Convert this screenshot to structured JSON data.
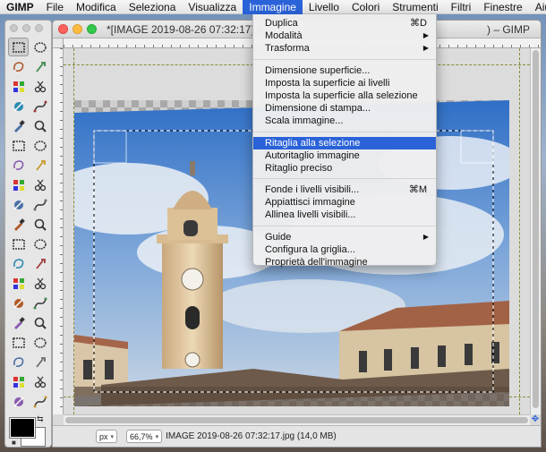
{
  "menubar": {
    "apple": "",
    "items": [
      "GIMP",
      "File",
      "Modifica",
      "Seleziona",
      "Visualizza",
      "Immagine",
      "Livello",
      "Colori",
      "Strumenti",
      "Filtri",
      "Finestre",
      "Aiuto"
    ],
    "active": "Immagine"
  },
  "window": {
    "title": "*[IMAGE 2019-08-26 07:32:17] (i",
    "title_suffix": ") – GIMP"
  },
  "menu": {
    "duplica": "Duplica",
    "duplica_sc": "⌘D",
    "modalita": "Modalità",
    "trasforma": "Trasforma",
    "dim_superficie": "Dimensione superficie...",
    "imposta_livelli": "Imposta la superficie ai livelli",
    "imposta_selezione": "Imposta la superficie alla selezione",
    "dim_stampa": "Dimensione di stampa...",
    "scala": "Scala immagine...",
    "ritaglia": "Ritaglia alla selezione",
    "autoritaglio": "Autoritaglio immagine",
    "ritaglio_preciso": "Ritaglio preciso",
    "fonde": "Fonde i livelli visibili...",
    "fonde_sc": "⌘M",
    "appiattisci": "Appiattisci immagine",
    "allinea": "Allinea livelli visibili...",
    "guide": "Guide",
    "griglia": "Configura la griglia...",
    "proprieta": "Proprietà dell'immagine",
    "highlighted": "Ritaglia alla selezione"
  },
  "status": {
    "unit": "px",
    "zoom": "66,7%",
    "file_info": "IMAGE 2019-08-26 07:32:17.jpg (14,0 MB)"
  },
  "toolbox": {
    "tools": [
      "rect-select-icon",
      "ellipse-select-icon",
      "lasso-icon",
      "fuzzy-select-icon",
      "color-select-icon",
      "scissors-icon",
      "foreground-select-icon",
      "paths-icon",
      "color-picker-icon",
      "zoom-icon",
      "measure-icon",
      "move-icon",
      "align-icon",
      "crop-icon",
      "rotate-icon",
      "scale-icon",
      "shear-icon",
      "perspective-icon",
      "unified-transform-icon",
      "handle-transform-icon",
      "flip-icon",
      "cage-icon",
      "warp-icon",
      "text-icon",
      "bucket-fill-icon",
      "gradient-icon",
      "pencil-icon",
      "paintbrush-icon",
      "eraser-icon",
      "airbrush-icon",
      "ink-icon",
      "mypaint-brush-icon",
      "clone-icon",
      "heal-icon",
      "perspective-clone-icon",
      "blur-icon",
      "smudge-icon",
      "dodge-burn-icon"
    ]
  },
  "colors": {
    "accent": "#2a62d8",
    "foreground": "#000000",
    "background": "#ffffff"
  }
}
